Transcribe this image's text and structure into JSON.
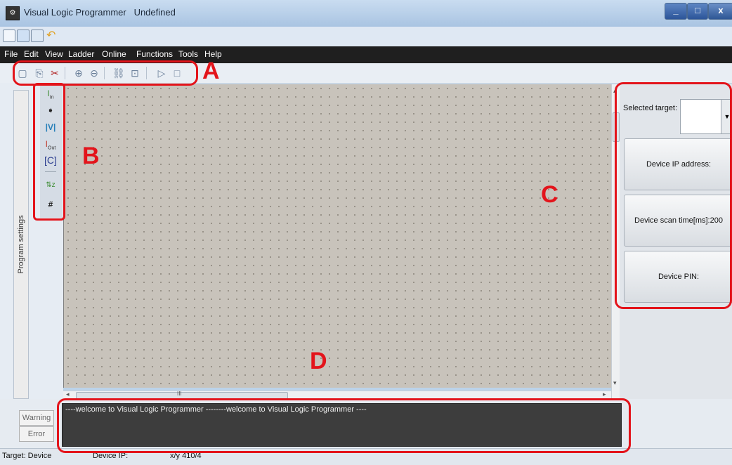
{
  "window": {
    "title": "Visual Logic Programmer",
    "document": "Undefined",
    "min": "_",
    "max": "□",
    "close": "x"
  },
  "menu": [
    "File",
    "Edit",
    "View",
    "Ladder",
    "Online",
    "Functions",
    "Tools",
    "Help"
  ],
  "toolbar_icons": [
    "select-icon",
    "copy-icon",
    "cut-icon",
    "zoom-in-icon",
    "zoom-out-icon",
    "link-icon",
    "target-icon",
    "run-icon",
    "stop-icon"
  ],
  "toolbar_glyphs": [
    "▢",
    "⎘",
    "✂",
    "⊕",
    "⊖",
    "⛓",
    "⊡",
    "▷",
    "□"
  ],
  "sidebar": {
    "program_settings": "Program settings"
  },
  "palette": [
    {
      "icon": "input-contact-icon",
      "glyph": "I",
      "sub": "In"
    },
    {
      "icon": "coil-icon",
      "glyph": "➧",
      "sub": ""
    },
    {
      "icon": "variable-icon",
      "glyph": "|V|",
      "sub": ""
    },
    {
      "icon": "output-icon",
      "glyph": "I",
      "sub": "Out"
    },
    {
      "icon": "constant-icon",
      "glyph": "[C]",
      "sub": ""
    },
    {
      "icon": "sort-icon",
      "glyph": "⇅z",
      "sub": ""
    },
    {
      "icon": "hash-icon",
      "glyph": "#",
      "sub": ""
    }
  ],
  "right_panel": {
    "selected_target_label": "Selected target:",
    "dropdown_arrow": "▼",
    "device_ip": "Device IP address:",
    "device_scan": "Device scan time[ms]:200",
    "device_pin": "Device PIN:"
  },
  "messages": "----welcome to Visual Logic Programmer --------welcome to Visual Logic Programmer ----",
  "side_buttons": {
    "warning": "Warning",
    "error": "Error"
  },
  "status": {
    "target": "Target: Device",
    "device_ip": "Device IP:",
    "xy": "x/y  410/4"
  },
  "annotations": {
    "A": "A",
    "B": "B",
    "C": "C",
    "D": "D"
  },
  "scroll": {
    "h_thumb": "III",
    "left_arrow": "◂",
    "right_arrow": "▸",
    "up_arrow": "▴",
    "down_arrow": "▾"
  }
}
